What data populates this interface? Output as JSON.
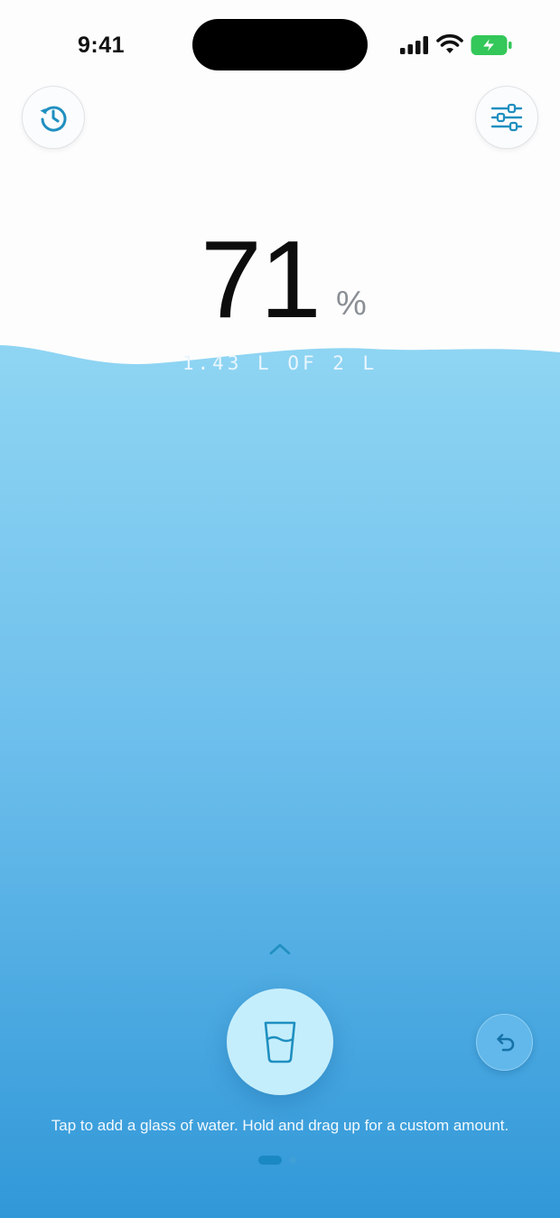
{
  "status_bar": {
    "time": "9:41"
  },
  "readout": {
    "percent": "71",
    "percent_sign": "%",
    "amount": "1.43 L OF 2 L",
    "fill_fraction": 0.71
  },
  "hint": "Tap to add a glass of water. Hold and drag up for a custom amount.",
  "pager": {
    "pages": 2,
    "active": 0
  },
  "colors": {
    "water_top": "#8fd5f3",
    "water_bottom": "#3198d8",
    "accent": "#1f8fc0",
    "add_button": "#c5eefc",
    "battery": "#34c759"
  },
  "icons": {
    "history": "history-icon",
    "settings": "sliders-icon",
    "add": "glass-icon",
    "undo": "undo-icon",
    "expand": "chevron-up-icon"
  }
}
